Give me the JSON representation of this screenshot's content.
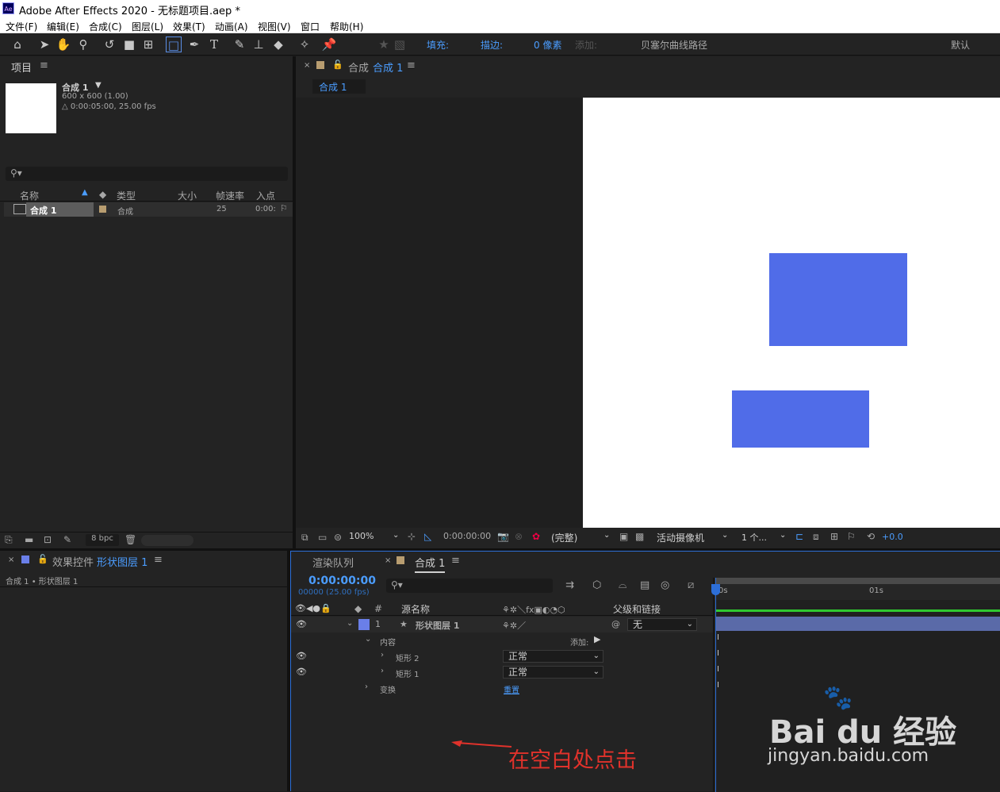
{
  "titlebar": {
    "logo": "Ae",
    "title": "Adobe After Effects 2020 - 无标题项目.aep *"
  },
  "menu": [
    "文件(F)",
    "编辑(E)",
    "合成(C)",
    "图层(L)",
    "效果(T)",
    "动画(A)",
    "视图(V)",
    "窗口",
    "帮助(H)"
  ],
  "toolbar": {
    "fill_label": "填充:",
    "fill_color": "#5470e6",
    "stroke_label": "描边:",
    "stroke_color": "#d0302a",
    "stroke_width": "0 像素",
    "add_label": "添加:",
    "bezier_label": "贝塞尔曲线路径",
    "workspace": "默认",
    "icons": [
      "home-icon",
      "selection-icon",
      "hand-icon",
      "zoom-icon",
      "rotate-icon",
      "camera-icon",
      "pan-behind-icon",
      "rectangle-icon",
      "pen-icon",
      "type-icon",
      "brush-icon",
      "clone-stamp-icon",
      "eraser-icon",
      "roto-brush-icon",
      "puppet-pin-icon"
    ]
  },
  "project": {
    "title": "项目",
    "comp_name": "合成 1",
    "comp_size": "600 x 600 (1.00)",
    "comp_duration": "△ 0:00:05:00, 25.00 fps",
    "columns": {
      "name": "名称",
      "type": "类型",
      "size": "大小",
      "fps": "帧速率",
      "in": "入点"
    },
    "items": [
      {
        "name": "合成 1",
        "type": "合成",
        "fps": "25",
        "in": "0:00:"
      }
    ],
    "bpc": "8 bpc"
  },
  "composition": {
    "tab_label": "合成",
    "tab_name": "合成 1",
    "subtab": "合成 1",
    "zoom": "100%",
    "timecode": "0:00:00:00",
    "resolution": "(完整)",
    "camera": "活动摄像机",
    "views": "1 个...",
    "exposure": "+0.0",
    "shapes": [
      {
        "name": "矩形 2",
        "color": "#506ce8"
      },
      {
        "name": "矩形 1",
        "color": "#506ce8"
      }
    ]
  },
  "effects": {
    "title": "效果控件",
    "layer": "形状图层 1",
    "breadcrumb": "合成 1 • 形状图层 1"
  },
  "timeline": {
    "render_queue": "渲染队列",
    "tab": "合成 1",
    "timecode": "0:00:00:00",
    "frame_info": "00000 (25.00 fps)",
    "col_hash": "#",
    "col_source": "源名称",
    "col_parent": "父级和链接",
    "ruler": [
      "0s",
      "01s"
    ],
    "layer": {
      "num": "1",
      "name": "形状图层 1",
      "parent": "无"
    },
    "contents_label": "内容",
    "add_label": "添加:",
    "rect2": "矩形 2",
    "rect1": "矩形 1",
    "blend_mode": "正常",
    "transform": "变换",
    "reset": "重置"
  },
  "annotation": {
    "text": "在空白处点击",
    "color": "#e0322b"
  },
  "watermark": {
    "brand": "Bai du 经验",
    "url": "jingyan.baidu.com"
  }
}
